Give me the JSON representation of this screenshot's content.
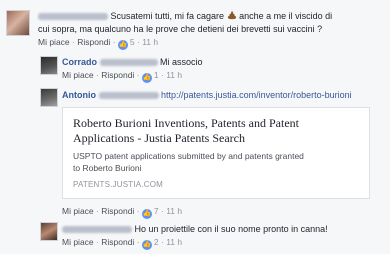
{
  "comments": [
    {
      "author_label": "",
      "text_line1": "Scusatemi tutti, mi fa cagare",
      "text_line1_after": "anche a me il viscido di",
      "text_line2": "cui sopra, ma qualcuno ha le prove che detieni dei brevetti sui vaccini ?",
      "like": "Mi piace",
      "reply": "Rispondi",
      "likes": "5",
      "time": "11 h"
    },
    {
      "author": "Corrado",
      "text": "Mi associo",
      "like": "Mi piace",
      "reply": "Rispondi",
      "likes": "1",
      "time": "11 h"
    },
    {
      "author": "Antonio",
      "text": "http://patents.justia.com/inventor/roberto-burioni",
      "link_card": {
        "title_line1": "Roberto Burioni Inventions, Patents and Patent",
        "title_line2": "Applications - Justia Patents Search",
        "desc_line1": "USPTO patent applications submitted by and patents granted",
        "desc_line2": "to Roberto Burioni",
        "source": "PATENTS.JUSTIA.COM"
      },
      "like": "Mi piace",
      "reply": "Rispondi",
      "likes": "7",
      "time": "11 h"
    },
    {
      "text": "Ho un proiettile con il suo nome pronto in canna!",
      "like": "Mi piace",
      "reply": "Rispondi",
      "likes": "2",
      "time": "11 h"
    }
  ],
  "icons": {
    "like_badge": "thumbs-up-icon",
    "emoji": "poop-emoji-icon"
  },
  "colors": {
    "name": "#365899",
    "like_badge": "#5890ff",
    "meta": "#90949c",
    "background": "#f6f7f9"
  }
}
